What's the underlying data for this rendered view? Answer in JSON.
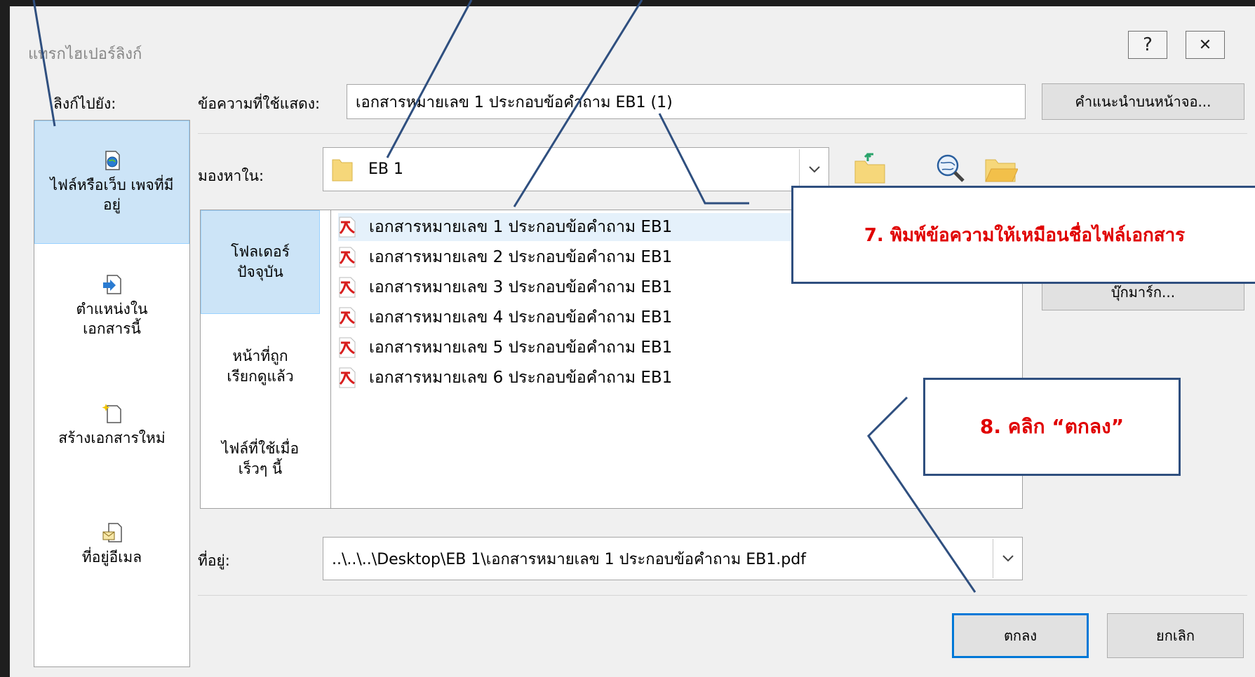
{
  "dialog": {
    "title": "แทรกไฮเปอร์ลิงก์",
    "help_glyph": "?",
    "close_glyph": "✕"
  },
  "link_to": {
    "label": "ลิงก์ไปยัง:",
    "items": [
      {
        "label": "ไฟล์หรือเว็บ เพจที่มีอยู่",
        "icon": "existing-file-web-icon",
        "selected": true
      },
      {
        "label": "ตำแหน่งในเอกสารนี้",
        "icon": "place-in-document-icon"
      },
      {
        "label": "สร้างเอกสารใหม่",
        "icon": "new-document-icon"
      },
      {
        "label": "ที่อยู่อีเมล",
        "icon": "email-address-icon"
      }
    ]
  },
  "text_to_display": {
    "label": "ข้อความที่ใช้แสดง:",
    "value": "เอกสารหมายเลข 1 ประกอบข้อคำถาม EB1 (1)",
    "screentip_button": "คำแนะนำบนหน้าจอ..."
  },
  "look_in": {
    "label": "มองหาใน:",
    "value": "EB 1"
  },
  "nav": [
    {
      "label": "โฟลเดอร์ ปัจจุบัน",
      "selected": true
    },
    {
      "label": "หน้าที่ถูก เรียกดูแล้ว"
    },
    {
      "label": "ไฟล์ที่ใช้เมื่อ เร็วๆ นี้"
    }
  ],
  "files": [
    "เอกสารหมายเลข 1 ประกอบข้อคำถาม EB1",
    "เอกสารหมายเลข 2 ประกอบข้อคำถาม EB1",
    "เอกสารหมายเลข 3 ประกอบข้อคำถาม EB1",
    "เอกสารหมายเลข 4 ประกอบข้อคำถาม EB1",
    "เอกสารหมายเลข 5 ประกอบข้อคำถาม EB1",
    "เอกสารหมายเลข 6 ประกอบข้อคำถาม EB1"
  ],
  "bookmark_button": "บุ๊กมาร์ก...",
  "address": {
    "label": "ที่อยู่:",
    "value": "..\\..\\..\\Desktop\\EB 1\\เอกสารหมายเลข 1 ประกอบข้อคำถาม EB1.pdf"
  },
  "buttons": {
    "ok": "ตกลง",
    "cancel": "ยกเลิก"
  },
  "annotations": {
    "step7": "7. พิมพ์ข้อความให้เหมือนชื่อไฟล์เอกสาร",
    "step8": "8. คลิก “ตกลง”"
  },
  "colors": {
    "callout_border": "#2f4f7f",
    "callout_text": "#e00000",
    "selection": "#cce4f7",
    "pdf_red": "#d81e1e"
  }
}
